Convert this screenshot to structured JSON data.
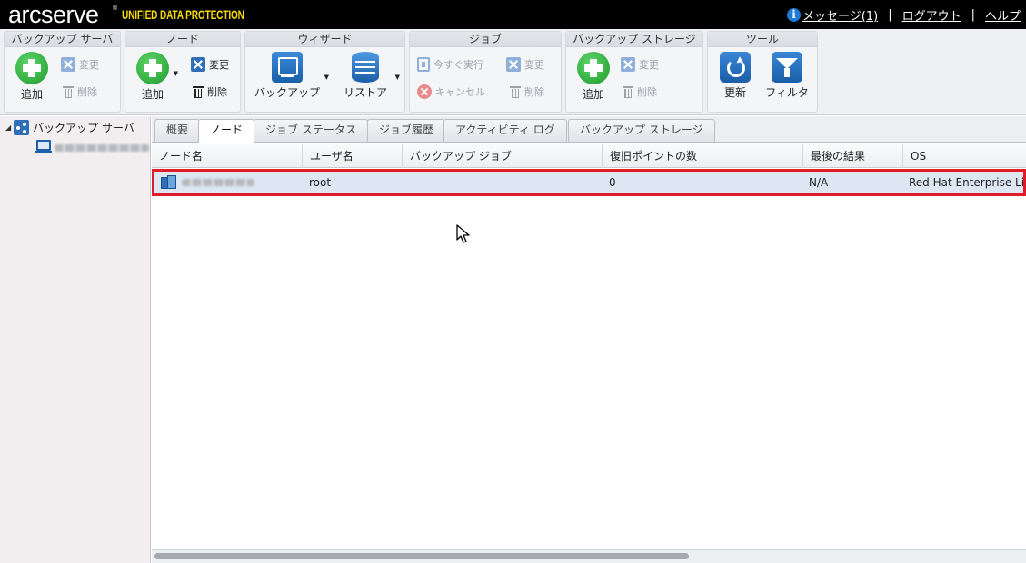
{
  "header": {
    "logo_text": "arcserve",
    "logo_reg": "®",
    "logo_subtitle": "UNIFIED DATA PROTECTION",
    "info_glyph": "i",
    "messages_link": "メッセージ(1)",
    "logout_link": "ログアウト",
    "help_link": "ヘルプ",
    "separator": "|"
  },
  "ribbon": {
    "backup_server": {
      "title": "バックアップ サーバ",
      "add": "追加",
      "edit": "変更",
      "delete": "削除"
    },
    "node": {
      "title": "ノード",
      "add": "追加",
      "edit": "変更",
      "delete": "削除"
    },
    "wizard": {
      "title": "ウィザード",
      "backup": "バックアップ",
      "restore": "リストア"
    },
    "job": {
      "title": "ジョブ",
      "run_now": "今すぐ実行",
      "edit": "変更",
      "cancel": "キャンセル",
      "delete": "削除"
    },
    "backup_storage": {
      "title": "バックアップ ストレージ",
      "add": "追加",
      "edit": "変更",
      "delete": "削除"
    },
    "tools": {
      "title": "ツール",
      "refresh": "更新",
      "filter": "フィルタ"
    }
  },
  "tree": {
    "root_label": "バックアップ サーバ",
    "toggle": "◢"
  },
  "tabs": [
    {
      "label": "概要"
    },
    {
      "label": "ノード"
    },
    {
      "label": "ジョブ ステータス"
    },
    {
      "label": "ジョブ履歴"
    },
    {
      "label": "アクティビティ ログ"
    },
    {
      "label": "バックアップ ストレージ"
    }
  ],
  "active_tab": "ノード",
  "grid": {
    "columns": [
      "ノード名",
      "ユーザ名",
      "バックアップ ジョブ",
      "復旧ポイントの数",
      "最後の結果",
      "OS"
    ],
    "rows": [
      {
        "node_name": "",
        "user": "root",
        "backup_job": "",
        "recovery_points": "0",
        "last_result": "N/A",
        "os": "Red Hat Enterprise Linux"
      }
    ]
  },
  "colors": {
    "header_bg": "#000000",
    "logo_accent": "#f5d90a",
    "selection_bg": "#dce7f3",
    "highlight_border": "#e01c2a",
    "icon_blue": "#2f6fb8",
    "add_green": "#1e9a2c"
  },
  "icons": {
    "info": "info-icon",
    "add": "plus-circle-icon",
    "edit": "x-box-icon",
    "delete": "trash-icon",
    "backup": "monitor-icon",
    "restore": "database-icon",
    "run_now": "run-icon",
    "cancel": "cancel-icon",
    "refresh": "refresh-icon",
    "filter": "filter-icon",
    "server_tree": "share-icon",
    "node": "node-icon",
    "computer": "computer-icon"
  }
}
